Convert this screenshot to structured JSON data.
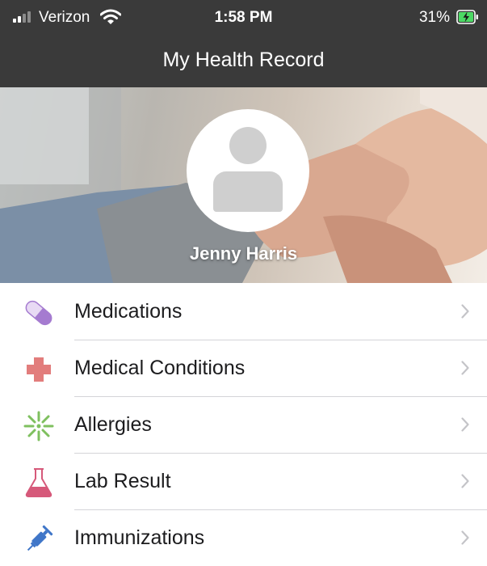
{
  "status_bar": {
    "carrier": "Verizon",
    "time": "1:58 PM",
    "battery": "31%",
    "icons": [
      "signal-icon",
      "wifi-icon",
      "battery-charging-icon"
    ]
  },
  "nav": {
    "title": "My Health Record"
  },
  "profile": {
    "name": "Jenny Harris",
    "avatar_icon": "person-icon"
  },
  "menu": {
    "items": [
      {
        "label": "Medications",
        "icon": "pill-icon",
        "color": "#a57bd0"
      },
      {
        "label": "Medical Conditions",
        "icon": "cross-icon",
        "color": "#e27d7c"
      },
      {
        "label": "Allergies",
        "icon": "allergy-icon",
        "color": "#7fc05f"
      },
      {
        "label": "Lab Result",
        "icon": "flask-icon",
        "color": "#d6597a"
      },
      {
        "label": "Immunizations",
        "icon": "syringe-icon",
        "color": "#3f76c8"
      }
    ]
  },
  "colors": {
    "header_bg": "#3a3a3a",
    "chevron": "#c4c4c8",
    "separator": "#d4d4d8"
  }
}
